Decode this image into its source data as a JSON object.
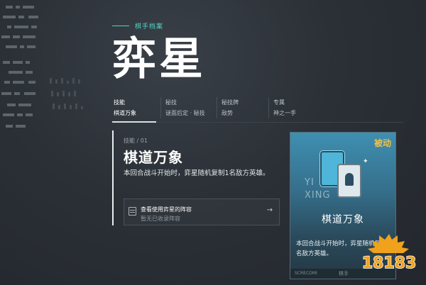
{
  "header": {
    "tagline": "棋手档案",
    "hero_title": "弈星"
  },
  "tabs": [
    {
      "key": "技能",
      "value": "棋道万象",
      "active": true
    },
    {
      "key": "秘技",
      "value": "谜面后定 · 秘技",
      "active": false
    },
    {
      "key": "秘技牌",
      "value": "敌势",
      "active": false
    },
    {
      "key": "专属",
      "value": "神之一手",
      "active": false
    }
  ],
  "skill": {
    "tag": "技能 / 01",
    "name": "棋道万象",
    "description": "本回合战斗开始时，弈星随机复制1名敌方英雄。"
  },
  "lineup": {
    "title": "查看使用弈星的阵容",
    "subtitle": "暂无已收录阵容",
    "arrow": "→"
  },
  "card": {
    "badge": "被动",
    "watermark_top": "YI",
    "watermark_bottom": "XING",
    "name": "棋道万象",
    "description": "本回合战斗开始时，弈星随机复制1名敌方英雄。",
    "footer_left": "SCRECOMI",
    "footer_right": "棋手"
  },
  "watermark_logo": {
    "text": "18183",
    "color_primary": "#f0a21c",
    "color_outline": "#ffffff"
  },
  "colors": {
    "accent": "#4fd6c4",
    "badge": "#f0c24b"
  }
}
